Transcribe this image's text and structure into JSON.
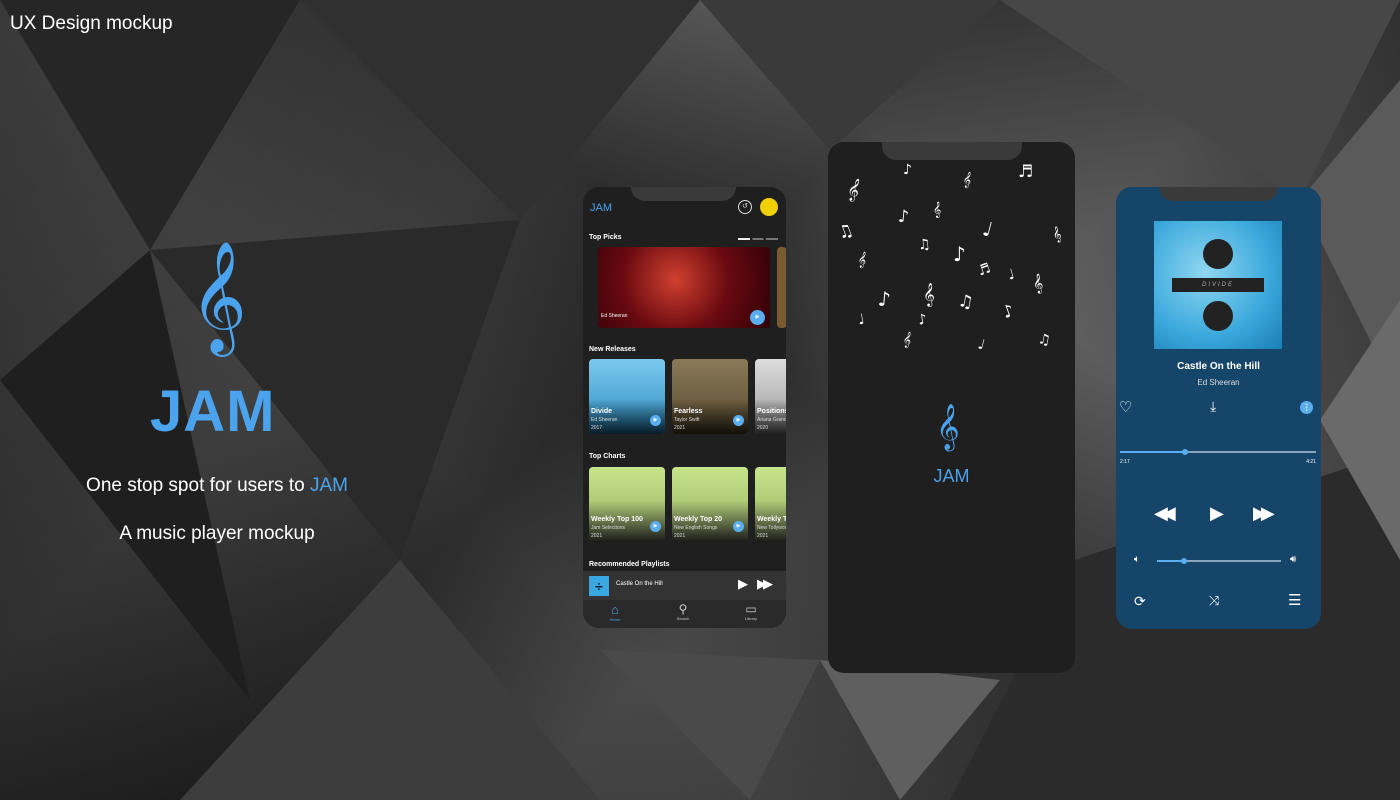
{
  "page": {
    "title": "UX Design mockup",
    "brand": "JAM",
    "tagline_prefix": "One stop spot for users to ",
    "tagline_highlight": "JAM",
    "subtitle": "A music player mockup"
  },
  "home": {
    "app_name": "JAM",
    "top_picks": "Top Picks",
    "top_pick_artist": "Ed Sheeran",
    "new_releases": "New Releases",
    "releases": [
      {
        "title": "Divide",
        "artist": "Ed Sheeran",
        "year": "2017"
      },
      {
        "title": "Fearless",
        "artist": "Taylor Swift",
        "year": "2021"
      },
      {
        "title": "Positions",
        "artist": "Ariana Grande",
        "year": "2020"
      }
    ],
    "top_charts": "Top Charts",
    "charts": [
      {
        "title": "Weekly Top 100",
        "sub": "Jam Selections",
        "year": "2021"
      },
      {
        "title": "Weekly Top 20",
        "sub": "New English Songs",
        "year": "2021"
      },
      {
        "title": "Weekly Top",
        "sub": "New Tollywood",
        "year": "2021"
      }
    ],
    "recommended": "Recommended Playlists",
    "mini_player_song": "Castle On the Hill",
    "nav": [
      {
        "label": "Home"
      },
      {
        "label": "Search"
      },
      {
        "label": "Library"
      }
    ]
  },
  "splash": {
    "app_name": "JAM"
  },
  "player": {
    "song": "Castle On the Hill",
    "artist": "Ed Sheeran",
    "album_text": "DIVIDE",
    "elapsed": "2:17",
    "duration": "4:21",
    "progress": 0.33,
    "volume": 0.22
  },
  "colors": {
    "accent": "#4aa3ec",
    "player_bg": "#154569"
  }
}
